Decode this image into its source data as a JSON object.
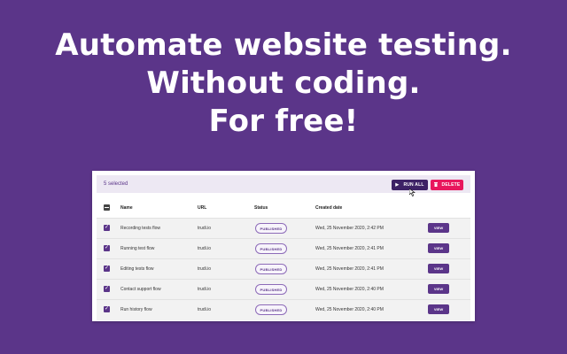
{
  "headline": {
    "line1": "Automate website testing.",
    "line2": "Without coding.",
    "line3": "For free!"
  },
  "toolbar": {
    "selected_text": "5 selected",
    "run_all_label": "RUN ALL",
    "delete_label": "DELETE"
  },
  "table": {
    "columns": [
      "Name",
      "URL",
      "Status",
      "Created date"
    ],
    "rows": [
      {
        "name": "Recording tests flow",
        "url": "trudi.io",
        "status": "PUBLISHED",
        "date": "Wed, 25 November 2020, 2:42 PM",
        "action": "VIEW"
      },
      {
        "name": "Running test flow",
        "url": "trudi.io",
        "status": "PUBLISHED",
        "date": "Wed, 25 November 2020, 2:41 PM",
        "action": "VIEW"
      },
      {
        "name": "Editing tests flow",
        "url": "trudi.io",
        "status": "PUBLISHED",
        "date": "Wed, 25 November 2020, 2:41 PM",
        "action": "VIEW"
      },
      {
        "name": "Contact support flow",
        "url": "trudi.io",
        "status": "PUBLISHED",
        "date": "Wed, 25 November 2020, 2:40 PM",
        "action": "VIEW"
      },
      {
        "name": "Run history flow",
        "url": "trudi.io",
        "status": "PUBLISHED",
        "date": "Wed, 25 November 2020, 2:40 PM",
        "action": "VIEW"
      }
    ]
  },
  "colors": {
    "background": "#5b3589",
    "run_all": "#3d2266",
    "delete": "#e8175d",
    "accent": "#5b3589"
  },
  "icons": {
    "run_all": "play-icon",
    "delete": "trash-icon",
    "checkbox": "check-icon",
    "header_checkbox": "indeterminate-checkbox-icon",
    "cursor": "mouse-pointer-icon"
  }
}
